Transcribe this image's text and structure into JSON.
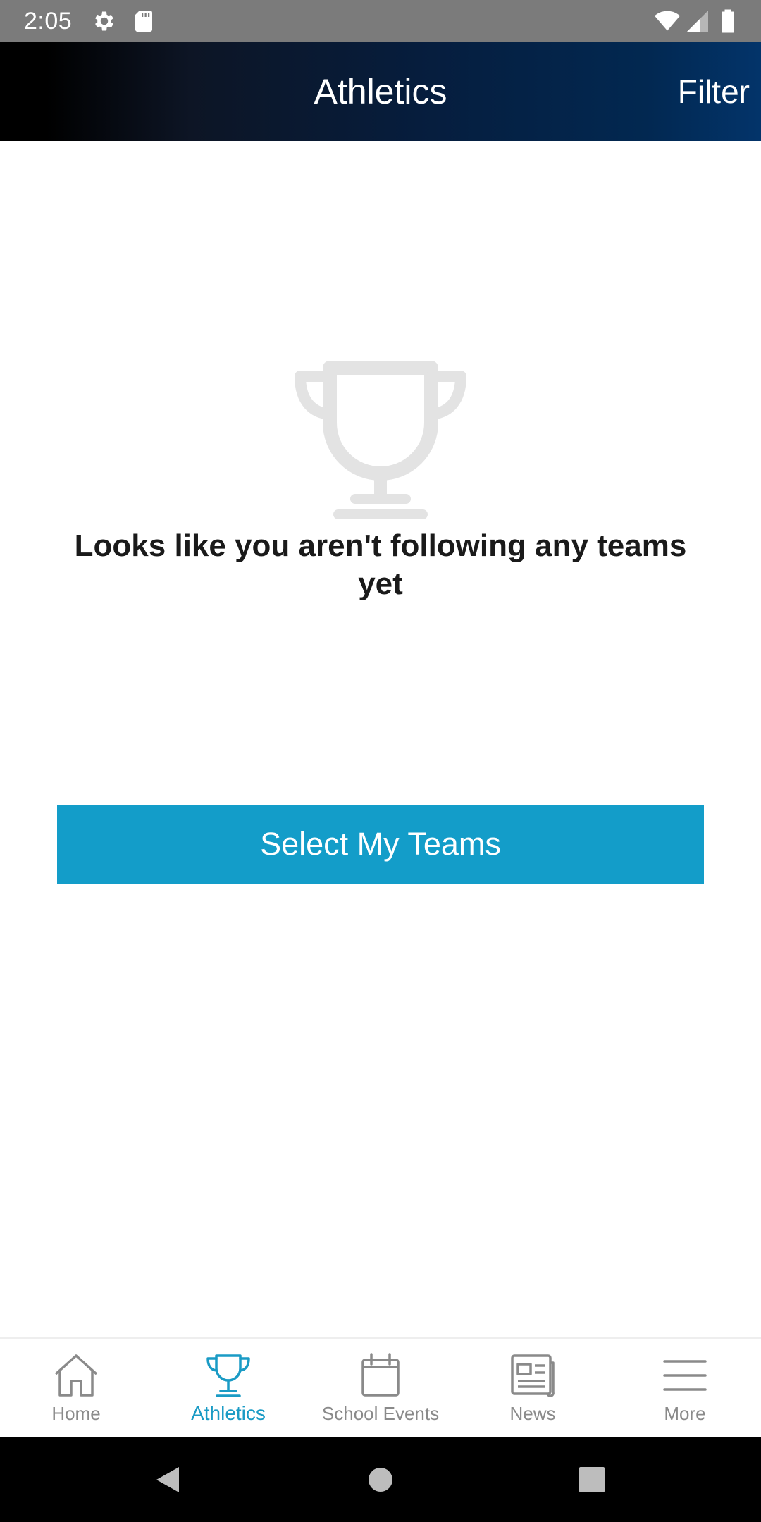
{
  "status_bar": {
    "time": "2:05",
    "icons": [
      "gear-icon",
      "sd-card-icon",
      "wifi-icon",
      "signal-icon",
      "battery-icon"
    ]
  },
  "header": {
    "title": "Athletics",
    "filter_label": "Filter"
  },
  "empty_state": {
    "icon": "trophy-icon",
    "message": "Looks like you aren't following any teams yet",
    "button_label": "Select My Teams"
  },
  "tab_bar": {
    "active_tab": "Athletics",
    "tabs": [
      {
        "label": "Home",
        "icon": "home-icon"
      },
      {
        "label": "Athletics",
        "icon": "trophy-icon"
      },
      {
        "label": "School Events",
        "icon": "calendar-icon"
      },
      {
        "label": "News",
        "icon": "newspaper-icon"
      },
      {
        "label": "More",
        "icon": "menu-icon"
      }
    ]
  },
  "nav_bar": {
    "buttons": [
      "back-icon",
      "home-circle-icon",
      "recents-icon"
    ]
  },
  "colors": {
    "accent": "#139dc9",
    "tab_active": "#1a9bc5",
    "tab_inactive": "#8a8a8a",
    "status_bar": "#7b7b7b",
    "header_dark": "#000000",
    "header_blue": "#03346a",
    "trophy_placeholder": "#e3e3e3"
  }
}
